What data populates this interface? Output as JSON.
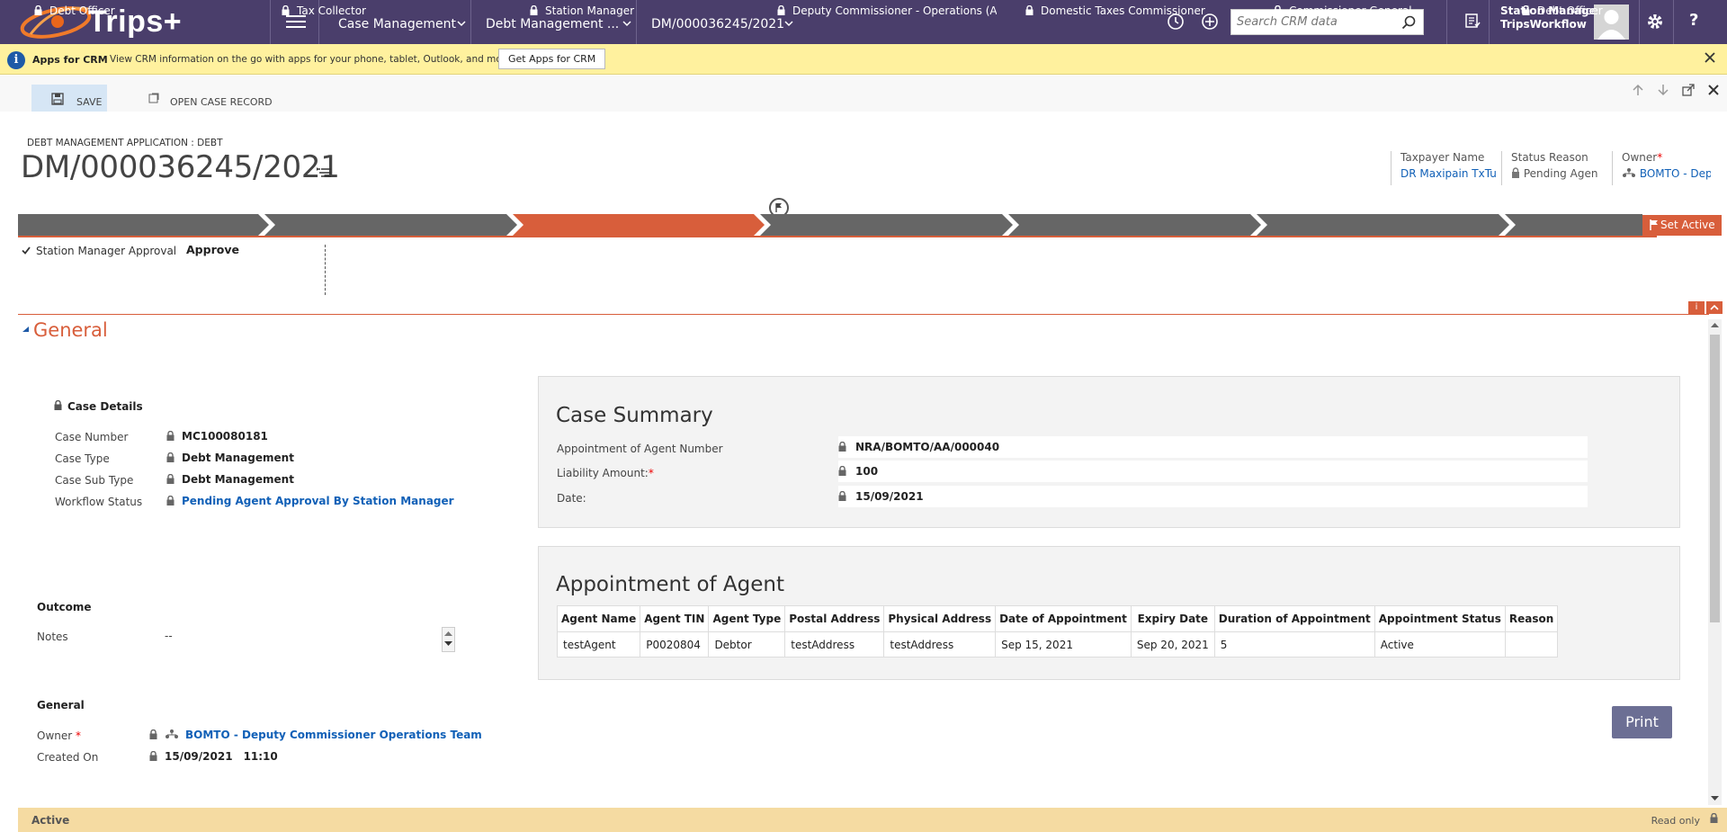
{
  "topnav": {
    "brand": "Trips+",
    "crumbs": [
      "Case Management",
      "Debt Management ...",
      "DM/000036245/2021"
    ],
    "search_placeholder": "Search CRM data",
    "user_name": "Station Manager",
    "user_org": "TripsWorkflow",
    "help": "?"
  },
  "notification": {
    "title": "Apps for CRM",
    "message": "View CRM information on the go with apps for your phone, tablet, Outlook, and more!",
    "button": "Get Apps for CRM"
  },
  "commands": {
    "save": "SAVE",
    "open_case": "OPEN CASE RECORD"
  },
  "header": {
    "entity_label": "DEBT MANAGEMENT APPLICATION : DEBT",
    "title": "DM/000036245/2021",
    "fields": [
      {
        "label": "Taxpayer Name",
        "value": "DR Maxipain TxTu"
      },
      {
        "label": "Status Reason",
        "value": "Pending Agen"
      },
      {
        "label": "Owner",
        "value": "BOMTO - Dep"
      }
    ]
  },
  "process": {
    "stages": [
      "Debt Officer",
      "Tax Collector",
      "Station Manager",
      "Deputy Commissioner - Operations (Active",
      "Domestic Taxes Commissioner",
      "Commissioner General",
      "Debt Officer"
    ],
    "active_index": 2,
    "set_active": "Set Active",
    "step_label": "Station Manager Approval",
    "step_value": "Approve"
  },
  "section": {
    "title": "General"
  },
  "case_details": {
    "heading": "Case Details",
    "rows": [
      {
        "label": "Case Number",
        "value": "MC100080181"
      },
      {
        "label": "Case Type",
        "value": "Debt Management"
      },
      {
        "label": "Case Sub Type",
        "value": "Debt Management"
      },
      {
        "label": "Workflow Status",
        "value": "Pending Agent Approval By Station Manager"
      }
    ]
  },
  "outcome": {
    "heading": "Outcome",
    "notes_label": "Notes",
    "notes_value": "--"
  },
  "general": {
    "heading": "General",
    "owner_label": "Owner",
    "owner_value": "BOMTO - Deputy Commissioner Operations Team",
    "created_label": "Created On",
    "created_date": "15/09/2021",
    "created_time": "11:10"
  },
  "case_summary": {
    "title": "Case Summary",
    "rows": [
      {
        "label": "Appointment of Agent Number",
        "value": "NRA/BOMTO/AA/000040"
      },
      {
        "label": "Liability Amount:",
        "value": "100"
      },
      {
        "label": "Date:",
        "value": "15/09/2021"
      }
    ]
  },
  "appointment": {
    "title": "Appointment of Agent",
    "columns": [
      "Agent Name",
      "Agent TIN",
      "Agent Type",
      "Postal Address",
      "Physical Address",
      "Date of Appointment",
      "Expiry Date",
      "Duration of Appointment",
      "Appointment Status",
      "Reason"
    ],
    "rows": [
      [
        "testAgent",
        "P0020804",
        "Debtor",
        "testAddress",
        "testAddress",
        "Sep 15, 2021",
        "Sep 20, 2021",
        "5",
        "Active",
        ""
      ]
    ]
  },
  "print_label": "Print",
  "status": {
    "state": "Active",
    "mode": "Read only"
  },
  "colors": {
    "nav": "#4a3e6b",
    "stage": "#666666",
    "active_stage": "#d85e3b",
    "link": "#1160b7",
    "notification": "#fff19e",
    "status_bar": "#f5dba2"
  }
}
